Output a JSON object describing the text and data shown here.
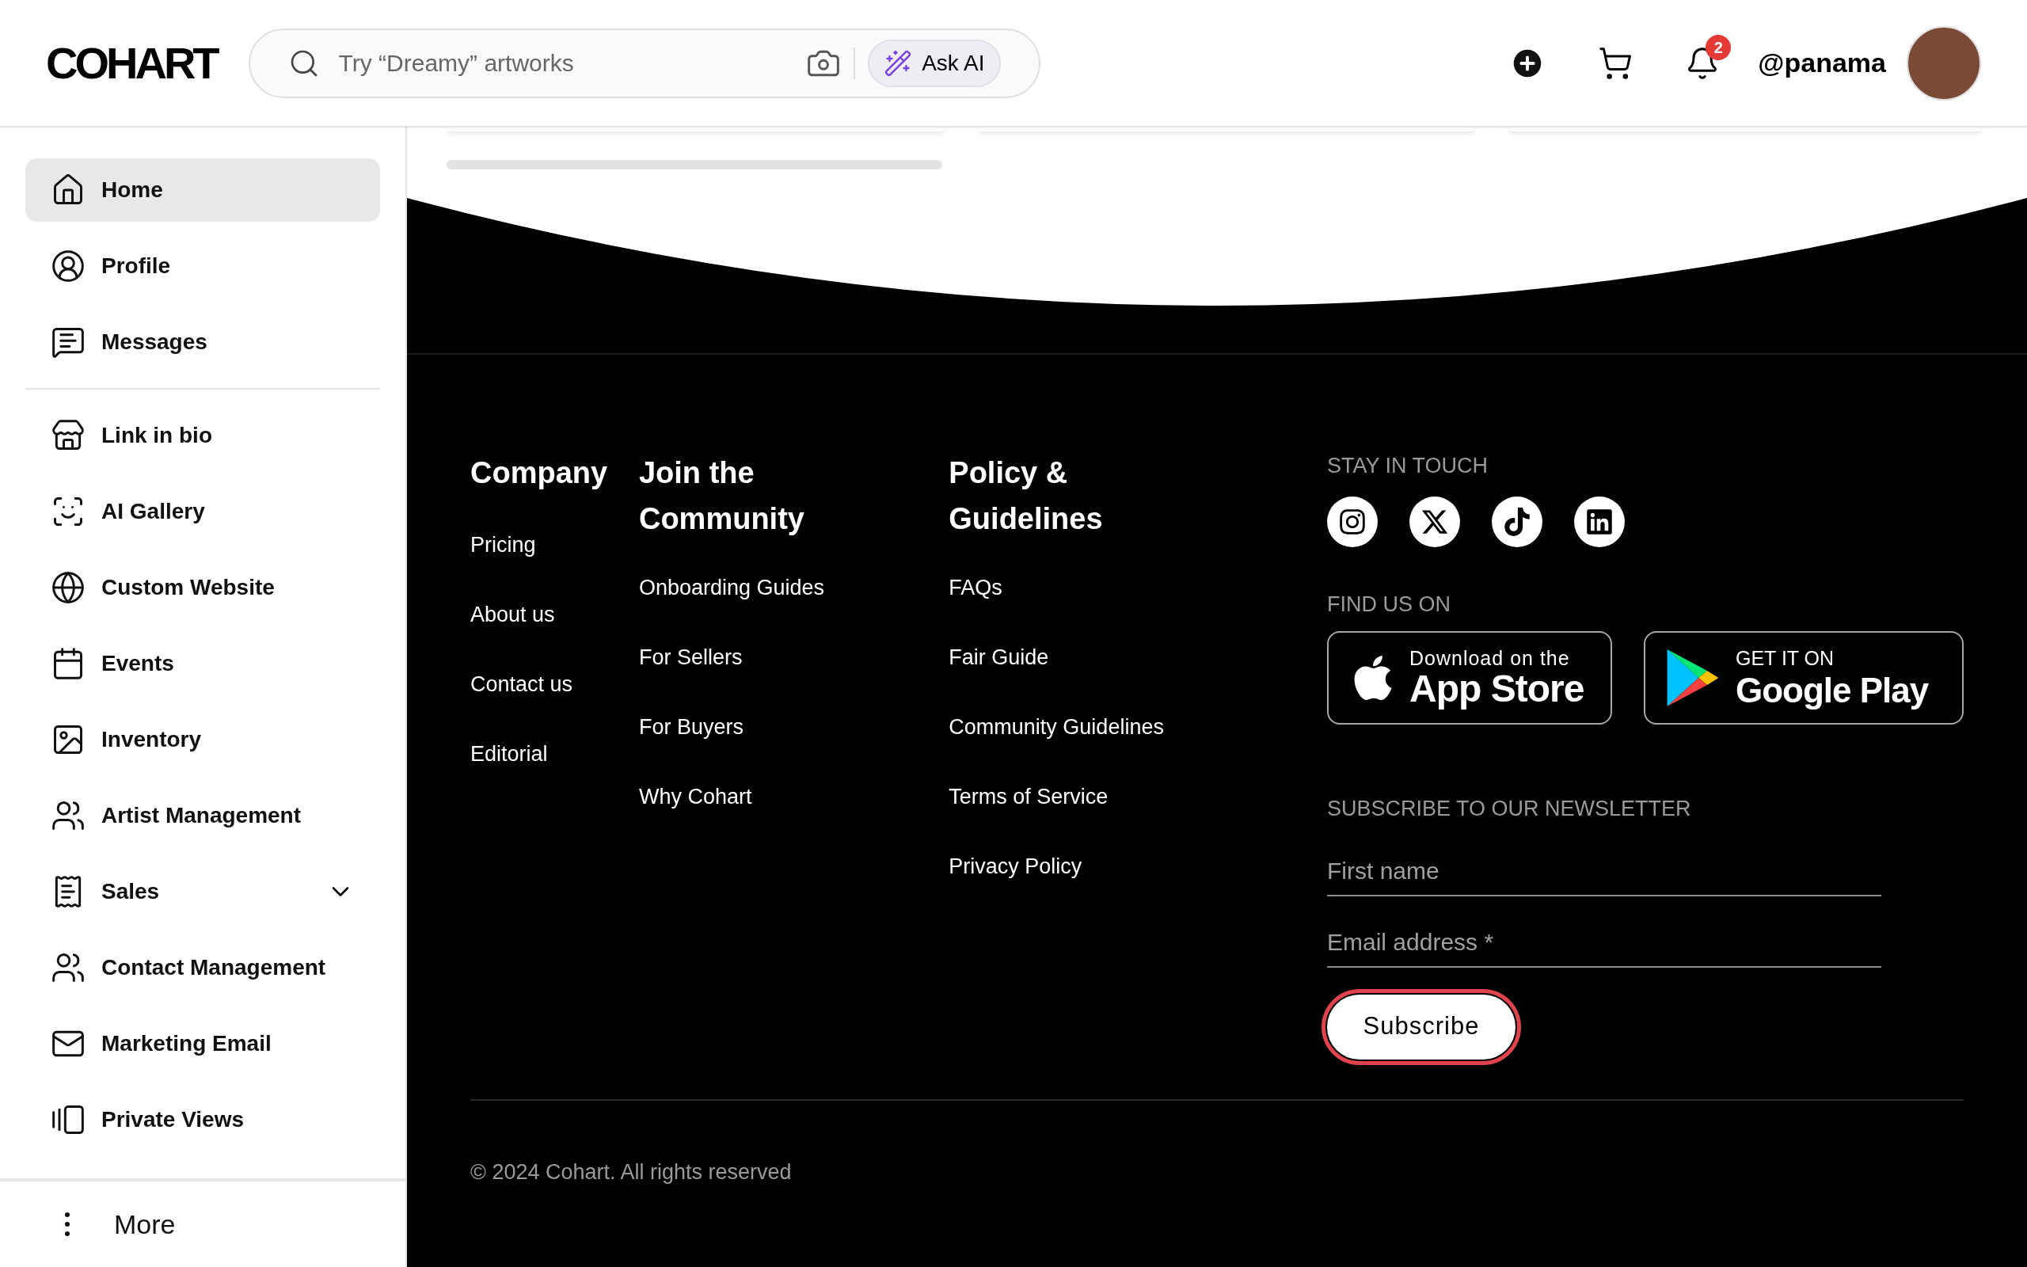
{
  "header": {
    "logo": "COHART",
    "search": {
      "placeholder": "Try “Dreamy” artworks"
    },
    "ask_ai": "Ask AI",
    "notifications_badge": "2",
    "username": "@panama"
  },
  "sidebar": {
    "items": [
      {
        "label": "Home",
        "selected": true
      },
      {
        "label": "Profile",
        "selected": false
      },
      {
        "label": "Messages",
        "selected": false
      }
    ],
    "tools": [
      {
        "label": "Link in bio",
        "selected": false
      },
      {
        "label": "AI Gallery",
        "selected": false
      },
      {
        "label": "Custom Website",
        "selected": false
      },
      {
        "label": "Events",
        "selected": false
      },
      {
        "label": "Inventory",
        "selected": false
      },
      {
        "label": "Artist Management",
        "selected": false
      },
      {
        "label": "Sales",
        "selected": false,
        "expanded": false
      },
      {
        "label": "Contact Management",
        "selected": false
      },
      {
        "label": "Marketing Email",
        "selected": false
      },
      {
        "label": "Private Views",
        "selected": false
      }
    ],
    "more": "More"
  },
  "footer": {
    "columns": [
      {
        "heading": "Company",
        "links": [
          "Pricing",
          "About us",
          "Contact us",
          "Editorial"
        ]
      },
      {
        "heading": "Join the Community",
        "links": [
          "Onboarding Guides",
          "For Sellers",
          "For Buyers",
          "Why Cohart"
        ]
      },
      {
        "heading": "Policy & Guidelines",
        "links": [
          "FAQs",
          "Fair Guide",
          "Community Guidelines",
          "Terms of Service",
          "Privacy Policy"
        ]
      }
    ],
    "stay_in_touch": "STAY IN TOUCH",
    "find_us_on": "FIND US ON",
    "app_store": {
      "small": "Download on the",
      "large": "App Store"
    },
    "google_play": {
      "small": "GET IT ON",
      "large": "Google Play"
    },
    "newsletter": {
      "heading": "SUBSCRIBE TO OUR NEWSLETTER",
      "first_name": {
        "placeholder": "First name"
      },
      "email": {
        "placeholder": "Email address *"
      },
      "button": "Subscribe",
      "focused": true
    },
    "copyright": "© 2024 Cohart. All rights reserved"
  }
}
